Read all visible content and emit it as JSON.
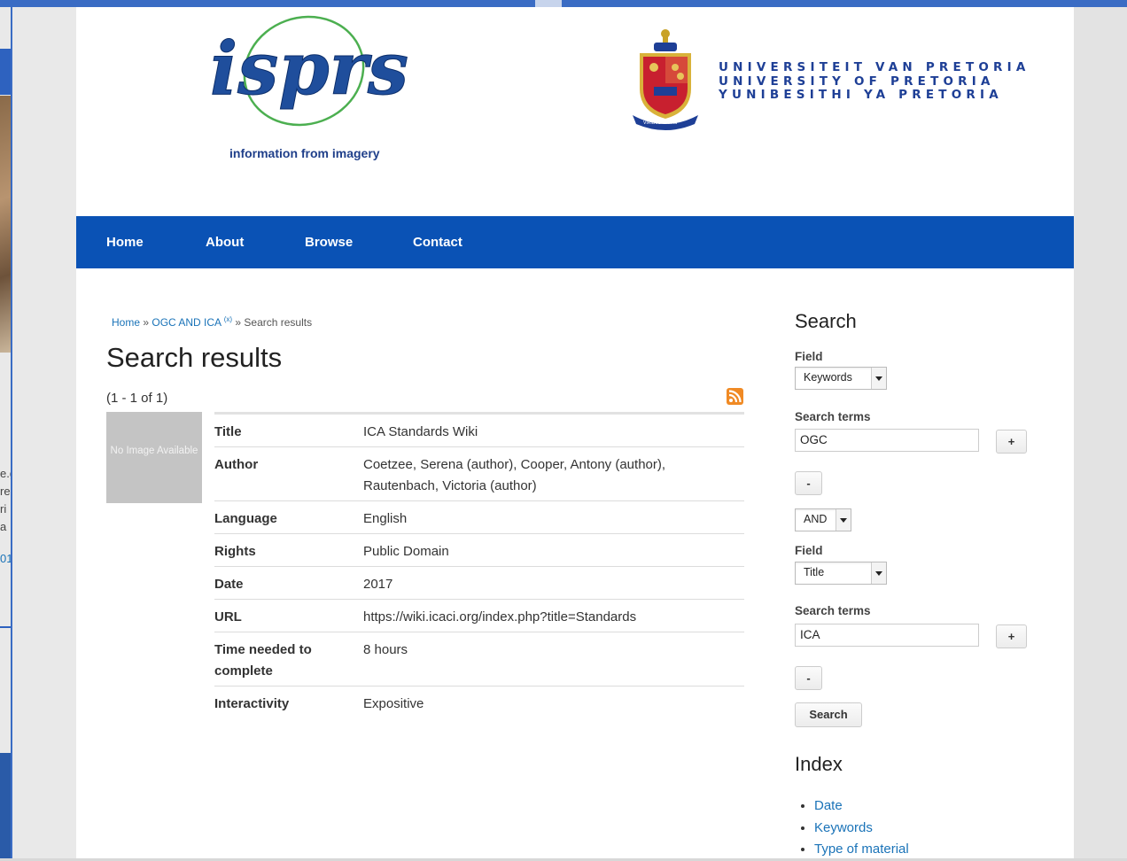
{
  "header": {
    "isprs_logo_text": "isprs",
    "isprs_tagline": "information from imagery",
    "university_lines": [
      "UNIVERSITEIT VAN PRETORIA",
      "UNIVERSITY OF PRETORIA",
      "YUNIBESITHI YA PRETORIA"
    ],
    "crest_motto": "VIRIBUS UNITIS"
  },
  "nav": {
    "items": [
      {
        "label": "Home"
      },
      {
        "label": "About"
      },
      {
        "label": "Browse"
      },
      {
        "label": "Contact"
      }
    ]
  },
  "breadcrumb": {
    "home": "Home",
    "sep1": " » ",
    "query": "OGC AND ICA",
    "remove": "(x)",
    "sep2": " » ",
    "current": "Search results"
  },
  "main": {
    "title": "Search results",
    "count": "(1 - 1 of 1)",
    "thumbnail_text": "No Image Available",
    "record": [
      {
        "key": "Title",
        "value": "ICA Standards Wiki"
      },
      {
        "key": "Author",
        "value": "Coetzee, Serena (author), Cooper, Antony (author), Rautenbach, Victoria (author)"
      },
      {
        "key": "Language",
        "value": "English"
      },
      {
        "key": "Rights",
        "value": "Public Domain"
      },
      {
        "key": "Date",
        "value": "2017"
      },
      {
        "key": "URL",
        "value": "https://wiki.icaci.org/index.php?title=Standards"
      },
      {
        "key": "Time needed to complete",
        "value": "8 hours"
      },
      {
        "key": "Interactivity",
        "value": "Expositive"
      }
    ]
  },
  "sidebar": {
    "search_heading": "Search",
    "field_label": "Field",
    "field1_value": "Keywords",
    "terms_label": "Search terms",
    "terms1_value": "OGC",
    "add_label": "+",
    "remove_label": "-",
    "operator_value": "AND",
    "field2_value": "Title",
    "terms2_value": "ICA",
    "search_button": "Search",
    "index_heading": "Index",
    "index_items": [
      "Date",
      "Keywords",
      "Type of material"
    ]
  },
  "background": {
    "text_fragments": [
      "e.g",
      "re",
      "ri",
      "a",
      "01"
    ]
  },
  "colors": {
    "nav_bg": "#0a52b5",
    "link": "#1a73b8",
    "rss": "#f08a24",
    "isprs_blue": "#1f4e9c"
  }
}
